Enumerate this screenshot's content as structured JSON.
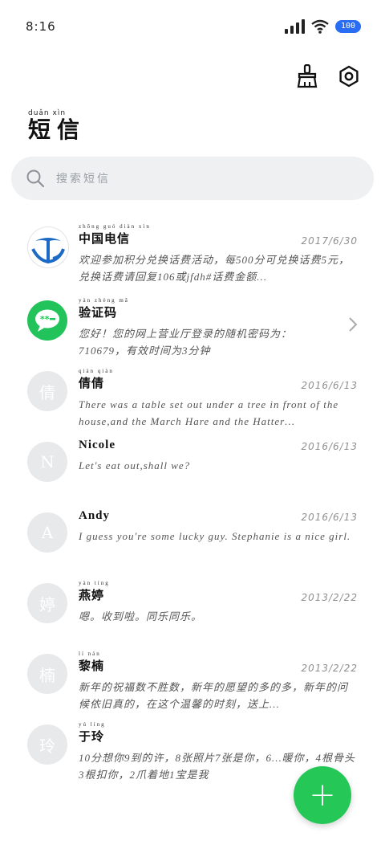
{
  "status": {
    "time": "8:16",
    "battery": "100"
  },
  "header": {
    "title_pinyin": "duǎn  xìn",
    "title": "短信"
  },
  "search": {
    "placeholder": "搜索短信"
  },
  "messages": [
    {
      "name": "中国电信",
      "name_pinyin": "zhōng guó diàn xìn",
      "date": "2017/6/30",
      "preview": "欢迎参加积分兑换话费活动，每500分可兑换话费5元，兑换话费请回复106或jfdh#话费金额…",
      "avatar": "telecom"
    },
    {
      "name": "验证码",
      "name_pinyin": "yàn zhèng mǎ",
      "date": "",
      "preview": "您好！您的网上营业厅登录的随机密码为：710679，有效时间为3分钟",
      "avatar": "message"
    },
    {
      "name": "倩倩",
      "name_pinyin": "qiàn qiàn",
      "date": "2016/6/13",
      "preview": "There was a table set out under a tree in front of the house,and the March Hare and the Hatter…",
      "avatar_text": "倩"
    },
    {
      "name": "Nicole",
      "name_pinyin": "",
      "date": "2016/6/13",
      "preview": "Let's eat out,shall we?",
      "avatar_text": "N"
    },
    {
      "name": "Andy",
      "name_pinyin": "",
      "date": "2016/6/13",
      "preview": "I guess you're some lucky guy. Stephanie is a nice girl.",
      "avatar_text": "A"
    },
    {
      "name": "燕婷",
      "name_pinyin": "yàn tíng",
      "date": "2013/2/22",
      "preview": "嗯。收到啦。同乐同乐。",
      "avatar_text": "婷"
    },
    {
      "name": "黎楠",
      "name_pinyin": "lí nán",
      "date": "2013/2/22",
      "preview": "新年的祝福数不胜数，新年的愿望的多的多，新年的问候依旧真的，在这个温馨的时刻，送上…",
      "avatar_text": "楠"
    },
    {
      "name": "于玲",
      "name_pinyin": "yú líng",
      "date": "",
      "preview": "10分想你9到的许，8张照片7张是你，6…暖你，4根骨头3根扣你，2爪着地1宝是我",
      "avatar_text": "玲"
    }
  ],
  "colors": {
    "accent": "#25c857",
    "battery": "#2a6df5"
  },
  "icons": {
    "clean": "broom-icon",
    "settings": "gear-icon",
    "search": "search-icon",
    "compose": "plus-icon"
  }
}
